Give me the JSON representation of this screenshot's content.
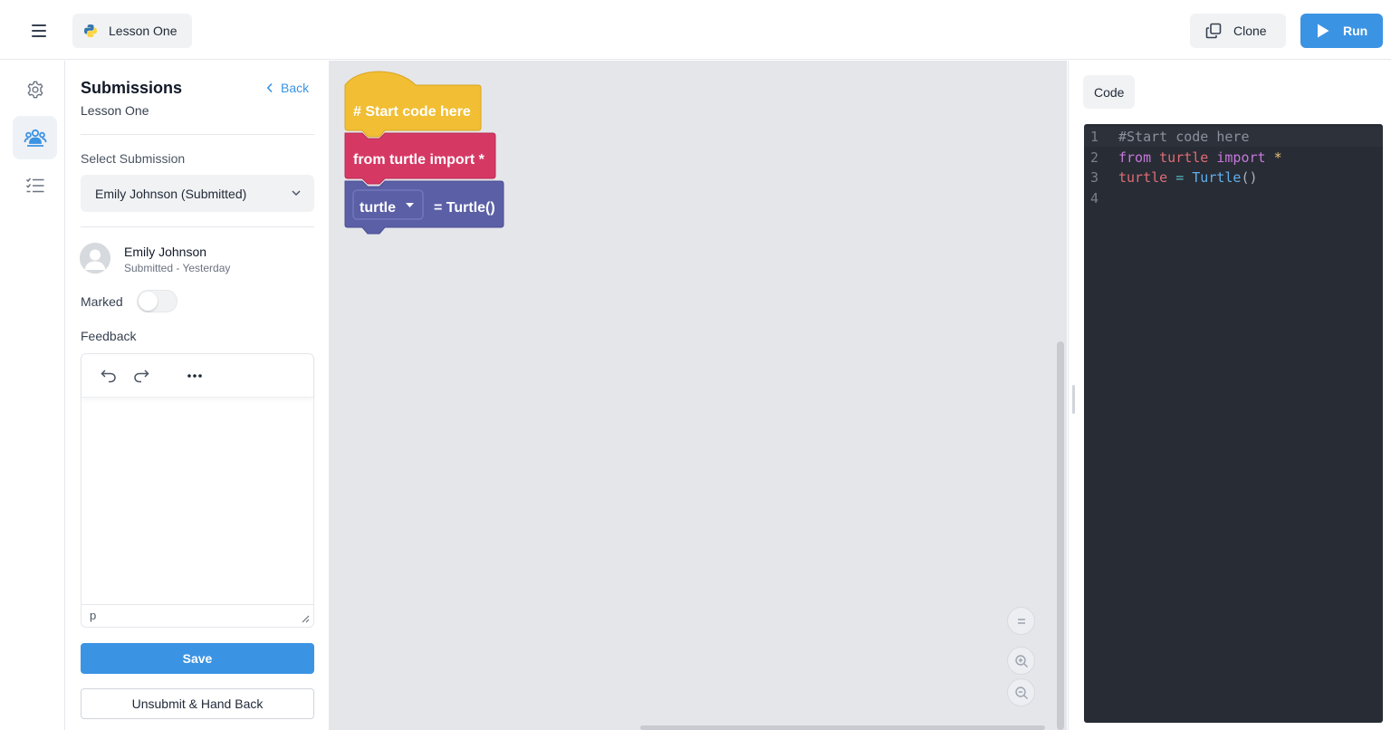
{
  "header": {
    "lesson_name": "Lesson One",
    "clone_label": "Clone",
    "run_label": "Run"
  },
  "rail": {
    "items": [
      {
        "icon": "settings-icon",
        "active": false
      },
      {
        "icon": "users-icon",
        "active": true
      },
      {
        "icon": "checklist-icon",
        "active": false
      }
    ]
  },
  "submissions": {
    "title": "Submissions",
    "subtitle": "Lesson One",
    "back_label": "Back",
    "select_label": "Select Submission",
    "selected_value": "Emily Johnson (Submitted)",
    "student": {
      "name": "Emily Johnson",
      "status": "Submitted - Yesterday"
    },
    "marked_label": "Marked",
    "marked": false,
    "feedback_label": "Feedback",
    "editor_status": "p",
    "save_label": "Save",
    "unsubmit_label": "Unsubmit & Hand Back"
  },
  "blocks": {
    "start": "# Start code here",
    "import": "from turtle import *",
    "var_name": "turtle",
    "assign": "= Turtle()"
  },
  "code_panel": {
    "tab_label": "Code",
    "lines": [
      {
        "number": "1",
        "tokens": [
          {
            "t": "#Start code here",
            "c": "c-comment"
          }
        ]
      },
      {
        "number": "2",
        "tokens": [
          {
            "t": "from",
            "c": "c-kw"
          },
          {
            "t": " ",
            "c": "c-plain"
          },
          {
            "t": "turtle",
            "c": "c-var"
          },
          {
            "t": " ",
            "c": "c-plain"
          },
          {
            "t": "import",
            "c": "c-kw"
          },
          {
            "t": " ",
            "c": "c-plain"
          },
          {
            "t": "*",
            "c": "c-star"
          }
        ]
      },
      {
        "number": "3",
        "tokens": [
          {
            "t": "turtle",
            "c": "c-var"
          },
          {
            "t": " ",
            "c": "c-plain"
          },
          {
            "t": "=",
            "c": "c-op"
          },
          {
            "t": " ",
            "c": "c-plain"
          },
          {
            "t": "Turtle",
            "c": "c-fn"
          },
          {
            "t": "()",
            "c": "c-plain"
          }
        ]
      },
      {
        "number": "4",
        "tokens": []
      }
    ]
  },
  "colors": {
    "accent": "#3b93e3",
    "block_yellow": "#f1be34",
    "block_red": "#d63864",
    "block_purple": "#5b5fa6",
    "code_bg": "#282c34"
  }
}
